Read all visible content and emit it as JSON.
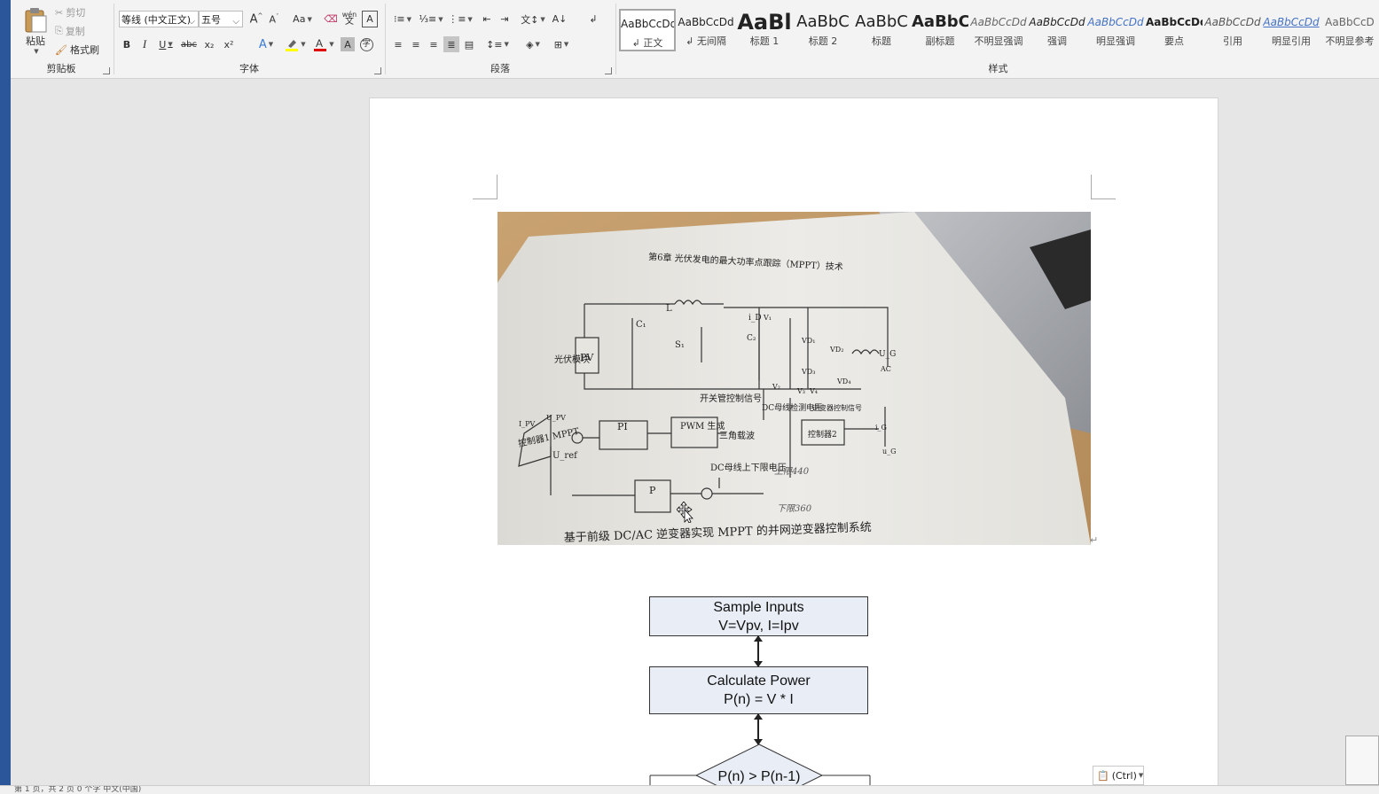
{
  "ribbon": {
    "clipboard": {
      "paste_label": "粘贴",
      "cut_label": "剪切",
      "copy_label": "复制",
      "format_painter_label": "格式刷",
      "group_label": "剪贴板"
    },
    "font": {
      "font_name": "等线 (中文正文)",
      "font_size": "五号",
      "change_case_label": "Aa",
      "bold": "B",
      "italic": "I",
      "underline": "U",
      "strike": "abc",
      "subscript": "x₂",
      "superscript": "x²",
      "pinyin_label": "wén",
      "group_label": "字体"
    },
    "paragraph": {
      "group_label": "段落"
    },
    "styles": {
      "group_label": "样式",
      "items": [
        {
          "sample": "AaBbCcDd",
          "name": "↲ 正文"
        },
        {
          "sample": "AaBbCcDd",
          "name": "↲ 无间隔"
        },
        {
          "sample": "AaBl",
          "name": "标题 1"
        },
        {
          "sample": "AaBbC",
          "name": "标题 2"
        },
        {
          "sample": "AaBbC",
          "name": "标题"
        },
        {
          "sample": "AaBbC",
          "name": "副标题"
        },
        {
          "sample": "AaBbCcDd",
          "name": "不明显强调"
        },
        {
          "sample": "AaBbCcDd",
          "name": "强调"
        },
        {
          "sample": "AaBbCcDd",
          "name": "明显强调"
        },
        {
          "sample": "AaBbCcDd",
          "name": "要点"
        },
        {
          "sample": "AaBbCcDd",
          "name": "引用"
        },
        {
          "sample": "AaBbCcDd",
          "name": "明显引用"
        },
        {
          "sample": "AaBbCcD",
          "name": "不明显参考"
        }
      ]
    }
  },
  "photo": {
    "header": "第6章   光伏发电的最大功率点跟踪（MPPT）技术",
    "caption": "基于前级 DC/AC 逆变器实现 MPPT 的并网逆变器控制系统",
    "labels": {
      "pv_module": "光伏模块",
      "pv": "PV",
      "c1": "C₁",
      "c2": "C₂",
      "L": "L",
      "s1": "S₁",
      "id": "i_D",
      "v1": "V₁",
      "v2": "V₂",
      "v3": "V₃",
      "v4": "V₄",
      "vd1": "VD₁",
      "vd2": "VD₂",
      "vd3": "VD₃",
      "vd4": "VD₄",
      "ug": "U_G",
      "ac": "AC",
      "ipv": "I_PV",
      "upv": "U_PV",
      "controller1": "控制器1 MPPT",
      "uref": "U_ref",
      "pi": "PI",
      "pwm": "PWM 生成",
      "switch_signal": "开关管控制信号",
      "triangle": "三角载波",
      "dc_detect": "DC母线检测电压",
      "inv_signal": "逆变器控制信号",
      "controller2": "控制器2",
      "ig": "i_G",
      "ug2": "u_G",
      "dc_limit": "DC母线上下限电压",
      "p": "P",
      "note1": "上限440",
      "note2": "下限360"
    }
  },
  "flowchart": {
    "box1": {
      "line1": "Sample Inputs",
      "line2": "V=Vpv, I=Ipv"
    },
    "box2": {
      "line1": "Calculate Power",
      "line2": "P(n) = V * I"
    },
    "decision": "P(n) > P(n-1)"
  },
  "paste_options_label": "(Ctrl)",
  "status_bar": "第 1 页，共 2 页    0 个字    中文(中国)",
  "colors": {
    "accent": "#2b579a",
    "highlight_yellow": "#ffff00",
    "font_red": "#e00000",
    "flow_fill": "#e9edf6"
  }
}
